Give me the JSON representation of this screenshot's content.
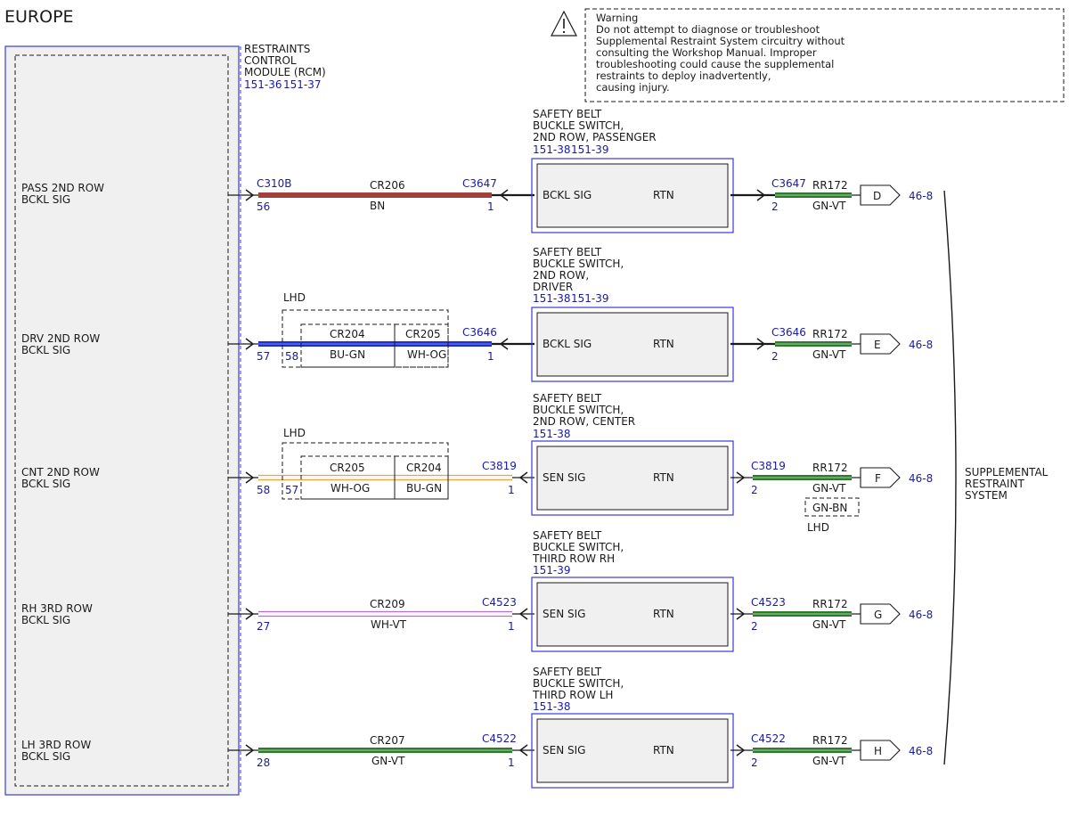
{
  "page": {
    "region_title": "EUROPE"
  },
  "warning": {
    "lines": [
      "Warning",
      "Do not attempt to diagnose or troubleshoot",
      "Supplemental Restraint System circuitry without",
      "consulting the Workshop Manual. Improper",
      "troubleshooting could cause the supplemental",
      "restraints to deploy inadvertently,",
      "causing injury."
    ]
  },
  "module": {
    "name_lines": [
      "RESTRAINTS",
      "CONTROL",
      "MODULE (RCM)"
    ],
    "refs": [
      "151-36",
      "151-37"
    ]
  },
  "circuits": [
    {
      "id": "pass2",
      "rcm_label": [
        "PASS 2ND ROW",
        "BCKL SIG"
      ],
      "rcm_connector": "C310B",
      "rcm_pin": "56",
      "wire": {
        "circuit": "CR206",
        "color": "BN",
        "colors": [
          "#a0413c"
        ]
      },
      "switch_connector": "C3647",
      "switch_pin": "1",
      "switch_title": [
        "SAFETY BELT",
        "BUCKLE SWITCH,",
        "2ND ROW, PASSENGER"
      ],
      "switch_refs": [
        "151-38",
        "151-39"
      ],
      "switch_in": "BCKL SIG",
      "switch_out": "RTN",
      "out_connector": "C3647",
      "out_pin": "2",
      "out_wire": {
        "circuit": "RR172",
        "color": "GN-VT"
      },
      "destination": "D",
      "page_ref": "46-8"
    },
    {
      "id": "drv2",
      "rcm_label": [
        "DRV 2ND ROW",
        "BCKL SIG"
      ],
      "rcm_connector": "",
      "rcm_pin": "57",
      "lhd_label": "LHD",
      "lhd_pin": "58",
      "wire_segments": [
        {
          "circuit": "CR204",
          "color": "BU-GN"
        },
        {
          "circuit": "CR205",
          "color": "WH-OG"
        }
      ],
      "switch_connector": "C3646",
      "switch_pin": "1",
      "switch_title": [
        "SAFETY BELT",
        "BUCKLE SWITCH,",
        "2ND ROW,",
        "DRIVER"
      ],
      "switch_refs": [
        "151-38",
        "151-39"
      ],
      "switch_in": "BCKL SIG",
      "switch_out": "RTN",
      "out_connector": "C3646",
      "out_pin": "2",
      "out_wire": {
        "circuit": "RR172",
        "color": "GN-VT"
      },
      "destination": "E",
      "page_ref": "46-8"
    },
    {
      "id": "cnt2",
      "rcm_label": [
        "CNT 2ND ROW",
        "BCKL SIG"
      ],
      "rcm_connector": "",
      "rcm_pin": "58",
      "lhd_label": "LHD",
      "lhd_pin": "57",
      "wire_segments": [
        {
          "circuit": "CR205",
          "color": "WH-OG"
        },
        {
          "circuit": "CR204",
          "color": "BU-GN"
        }
      ],
      "switch_connector": "C3819",
      "switch_pin": "1",
      "switch_title": [
        "SAFETY BELT",
        "BUCKLE SWITCH,",
        "2ND ROW, CENTER"
      ],
      "switch_refs": [
        "151-38"
      ],
      "switch_in": "SEN SIG",
      "switch_out": "RTN",
      "out_connector": "C3819",
      "out_pin": "2",
      "out_wire": {
        "circuit": "RR172",
        "color": "GN-VT"
      },
      "out_alt_color": "GN-BN",
      "out_alt_label": "LHD",
      "destination": "F",
      "page_ref": "46-8"
    },
    {
      "id": "rh3",
      "rcm_label": [
        "RH 3RD ROW",
        "BCKL SIG"
      ],
      "rcm_connector": "",
      "rcm_pin": "27",
      "wire": {
        "circuit": "CR209",
        "color": "WH-VT"
      },
      "switch_connector": "C4523",
      "switch_pin": "1",
      "switch_title": [
        "SAFETY BELT",
        "BUCKLE SWITCH,",
        "THIRD ROW RH"
      ],
      "switch_refs": [
        "151-39"
      ],
      "switch_in": "SEN SIG",
      "switch_out": "RTN",
      "out_connector": "C4523",
      "out_pin": "2",
      "out_wire": {
        "circuit": "RR172",
        "color": "GN-VT"
      },
      "destination": "G",
      "page_ref": "46-8"
    },
    {
      "id": "lh3",
      "rcm_label": [
        "LH 3RD ROW",
        "BCKL SIG"
      ],
      "rcm_connector": "",
      "rcm_pin": "28",
      "wire": {
        "circuit": "CR207",
        "color": "GN-VT"
      },
      "switch_connector": "C4522",
      "switch_pin": "1",
      "switch_title": [
        "SAFETY BELT",
        "BUCKLE SWITCH,",
        "THIRD ROW LH"
      ],
      "switch_refs": [
        "151-38"
      ],
      "switch_in": "SEN SIG",
      "switch_out": "RTN",
      "out_connector": "C4522",
      "out_pin": "2",
      "out_wire": {
        "circuit": "RR172",
        "color": "GN-VT"
      },
      "destination": "H",
      "page_ref": "46-8"
    }
  ],
  "system": {
    "name_lines": [
      "SUPPLEMENTAL",
      "RESTRAINT",
      "SYSTEM"
    ]
  },
  "colors": {
    "reference_blue": "#1a1aa8",
    "module_border": "#3a3ad8",
    "module_fill": "#f0f0f0",
    "wire_brown": "#a0413c",
    "wire_blue": "#1e2fd0",
    "wire_green": "#2f7a2f",
    "wire_orange": "#e8a04a",
    "wire_violet": "#b070c8"
  }
}
